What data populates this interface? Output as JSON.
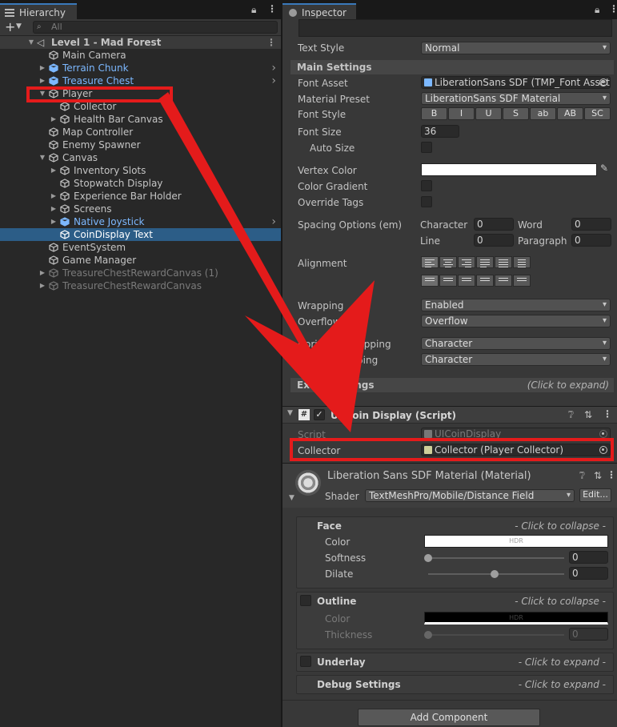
{
  "hierarchy": {
    "tab_label": "Hierarchy",
    "search_placeholder": "All",
    "scene_name": "Level 1 - Mad Forest",
    "items": [
      {
        "label": "Main Camera",
        "depth": 1,
        "fold": "none",
        "kind": "normal"
      },
      {
        "label": "Terrain Chunk",
        "depth": 1,
        "fold": "closed",
        "kind": "prefab"
      },
      {
        "label": "Treasure Chest",
        "depth": 1,
        "fold": "closed",
        "kind": "prefab"
      },
      {
        "label": "Player",
        "depth": 1,
        "fold": "open",
        "kind": "normal"
      },
      {
        "label": "Collector",
        "depth": 2,
        "fold": "none",
        "kind": "normal"
      },
      {
        "label": "Health Bar Canvas",
        "depth": 2,
        "fold": "closed",
        "kind": "normal"
      },
      {
        "label": "Map Controller",
        "depth": 1,
        "fold": "none",
        "kind": "normal"
      },
      {
        "label": "Enemy Spawner",
        "depth": 1,
        "fold": "none",
        "kind": "normal"
      },
      {
        "label": "Canvas",
        "depth": 1,
        "fold": "open",
        "kind": "normal"
      },
      {
        "label": "Inventory Slots",
        "depth": 2,
        "fold": "closed",
        "kind": "normal"
      },
      {
        "label": "Stopwatch Display",
        "depth": 2,
        "fold": "none",
        "kind": "normal"
      },
      {
        "label": "Experience Bar Holder",
        "depth": 2,
        "fold": "closed",
        "kind": "normal"
      },
      {
        "label": "Screens",
        "depth": 2,
        "fold": "closed",
        "kind": "normal"
      },
      {
        "label": "Native Joystick",
        "depth": 2,
        "fold": "closed",
        "kind": "prefab"
      },
      {
        "label": "CoinDisplay Text",
        "depth": 2,
        "fold": "none",
        "kind": "selected"
      },
      {
        "label": "EventSystem",
        "depth": 1,
        "fold": "none",
        "kind": "normal"
      },
      {
        "label": "Game Manager",
        "depth": 1,
        "fold": "none",
        "kind": "normal"
      },
      {
        "label": "TreasureChestRewardCanvas (1)",
        "depth": 1,
        "fold": "closed",
        "kind": "inactive"
      },
      {
        "label": "TreasureChestRewardCanvas",
        "depth": 1,
        "fold": "closed",
        "kind": "inactive"
      }
    ]
  },
  "inspector": {
    "tab_label": "Inspector",
    "text_style_label": "Text Style",
    "text_style_value": "Normal",
    "main_settings": "Main Settings",
    "font_asset_label": "Font Asset",
    "font_asset_value": "LiberationSans SDF (TMP_Font Asset)",
    "material_preset_label": "Material Preset",
    "material_preset_value": "LiberationSans SDF Material",
    "font_style_label": "Font Style",
    "font_style_buttons": [
      "B",
      "I",
      "U",
      "S",
      "ab",
      "AB",
      "SC"
    ],
    "font_size_label": "Font Size",
    "font_size_value": "36",
    "auto_size_label": "Auto Size",
    "vertex_color_label": "Vertex Color",
    "color_gradient_label": "Color Gradient",
    "override_tags_label": "Override Tags",
    "spacing_label": "Spacing Options (em)",
    "character_label": "Character",
    "character_value": "0",
    "word_label": "Word",
    "word_value": "0",
    "line_label": "Line",
    "line_value": "0",
    "paragraph_label": "Paragraph",
    "paragraph_value": "0",
    "alignment_label": "Alignment",
    "wrapping_label": "Wrapping",
    "wrapping_value": "Enabled",
    "overflow_label": "Overflow",
    "overflow_value": "Overflow",
    "horizontal_mapping_label": "Horizontal Mapping",
    "horizontal_mapping_value": "Character",
    "vertical_mapping_label": "Vertical Mapping",
    "vertical_mapping_value": "Character",
    "extra_settings": "Extra Settings",
    "click_to_expand": "(Click to expand)",
    "component_title": "UI Coin Display (Script)",
    "script_label": "Script",
    "script_value": "UICoinDisplay",
    "collector_label": "Collector",
    "collector_value": "Collector (Player Collector)",
    "material_title": "Liberation Sans SDF Material (Material)",
    "shader_label": "Shader",
    "shader_value": "TextMeshPro/Mobile/Distance Field",
    "edit_button": "Edit...",
    "face_label": "Face",
    "click_to_collapse": "- Click to collapse -",
    "color_label": "Color",
    "hdr_label": "HDR",
    "softness_label": "Softness",
    "softness_value": "0",
    "dilate_label": "Dilate",
    "dilate_value": "0",
    "outline_label": "Outline",
    "thickness_label": "Thickness",
    "thickness_value": "0",
    "underlay_label": "Underlay",
    "click_to_expand_dash": "- Click to expand -",
    "debug_settings_label": "Debug Settings",
    "add_component": "Add Component"
  },
  "colors": {
    "selection": "#2c5d87",
    "prefab_text": "#7cb8ff",
    "annotation_red": "#e41b1b",
    "tab_accent": "#3a79bb"
  },
  "icons": {
    "hierarchy_tab": "list-icon",
    "inspector_tab": "info-icon",
    "lock": "lock-icon",
    "menu": "kebab-menu-icon",
    "search": "search-icon",
    "add": "plus-icon"
  }
}
